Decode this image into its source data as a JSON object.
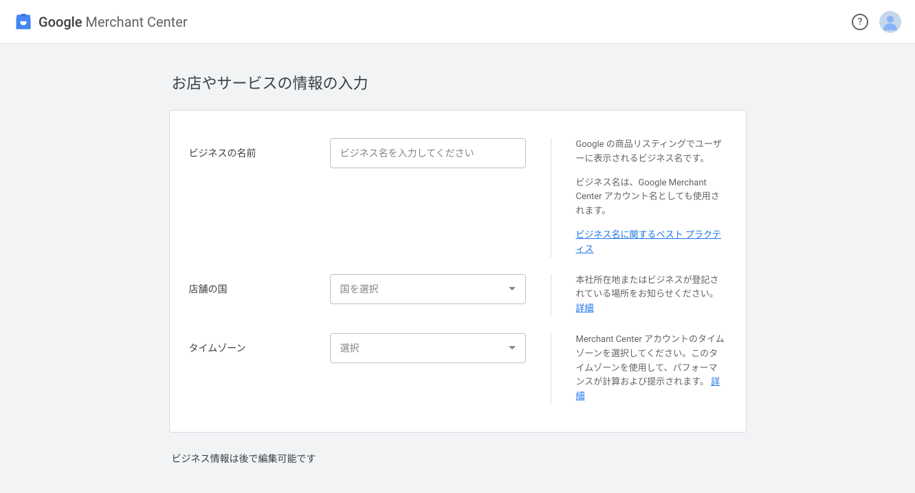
{
  "header": {
    "logo_google": "Google",
    "logo_rest": " Merchant Center"
  },
  "page": {
    "title": "お店やサービスの情報の入力",
    "footer_note": "ビジネス情報は後で編集可能です"
  },
  "fields": {
    "business_name": {
      "label": "ビジネスの名前",
      "placeholder": "ビジネス名を入力してください",
      "help1": "Google の商品リスティングでユーザーに表示されるビジネス名です。",
      "help2": "ビジネス名は、Google Merchant Center アカウント名としても使用されます。",
      "link": "ビジネス名に関するベスト プラクティス"
    },
    "country": {
      "label": "店舗の国",
      "placeholder": "国を選択",
      "help": "本社所在地またはビジネスが登記されている場所をお知らせください。",
      "link": "詳細"
    },
    "timezone": {
      "label": "タイムゾーン",
      "placeholder": "選択",
      "help": "Merchant Center アカウントのタイムゾーンを選択してください。このタイムゾーンを使用して、パフォーマンスが計算および提示されます。",
      "link": "詳細"
    }
  }
}
